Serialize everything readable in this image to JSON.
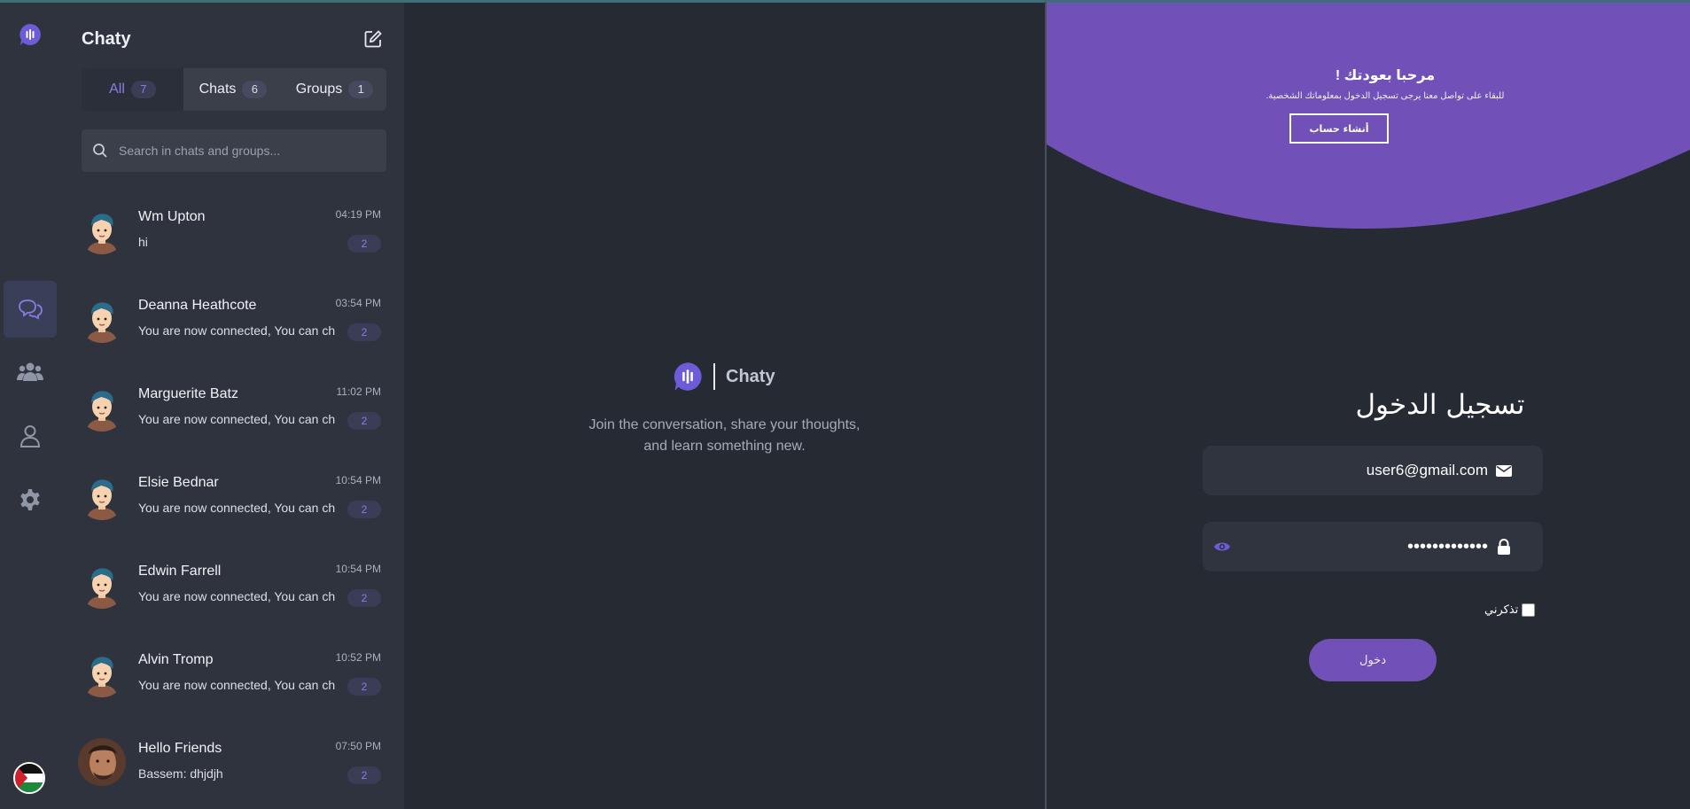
{
  "app": {
    "name": "Chaty"
  },
  "rail": {
    "icons": [
      "logo-icon",
      "chats-icon",
      "groups-icon",
      "profile-icon",
      "settings-icon"
    ]
  },
  "panel": {
    "title": "Chaty",
    "tabs": [
      {
        "label": "All",
        "count": "7"
      },
      {
        "label": "Chats",
        "count": "6"
      },
      {
        "label": "Groups",
        "count": "1"
      }
    ],
    "search": {
      "placeholder": "Search in chats and groups..."
    },
    "chats": [
      {
        "name": "Wm Upton",
        "time": "04:19 PM",
        "message": "hi",
        "unread": "2"
      },
      {
        "name": "Deanna Heathcote",
        "time": "03:54 PM",
        "message": "You are now connected, You can chat",
        "unread": "2"
      },
      {
        "name": "Marguerite Batz",
        "time": "11:02 PM",
        "message": "You are now connected, You can chat",
        "unread": "2"
      },
      {
        "name": "Elsie Bednar",
        "time": "10:54 PM",
        "message": "You are now connected, You can chat",
        "unread": "2"
      },
      {
        "name": "Edwin Farrell",
        "time": "10:54 PM",
        "message": "You are now connected, You can chat",
        "unread": "2"
      },
      {
        "name": "Alvin Tromp",
        "time": "10:52 PM",
        "message": "You are now connected, You can chat",
        "unread": "2"
      },
      {
        "name": "Hello Friends",
        "time": "07:50 PM",
        "message": "Bassem: dhjdjh",
        "unread": "2"
      }
    ]
  },
  "center": {
    "brand": "Chaty",
    "tagline_line1": "Join the conversation, share your thoughts,",
    "tagline_line2": "and learn something new."
  },
  "login": {
    "welcome_title": "مرحبا بعودتك !",
    "welcome_text": "للبقاء على تواصل معنا يرجى تسجيل الدخول بمعلوماتك الشخصية.",
    "create_account": "أنشاء حساب",
    "title": "تسجيل الدخول",
    "email": "user6@gmail.com",
    "password_mask": "•••••••••••••",
    "remember": "تذكرني",
    "submit": "دخول"
  },
  "colors": {
    "accent": "#7151b7",
    "brand": "#8b7ce6",
    "background": "#262a33",
    "panel": "#2f333d"
  }
}
